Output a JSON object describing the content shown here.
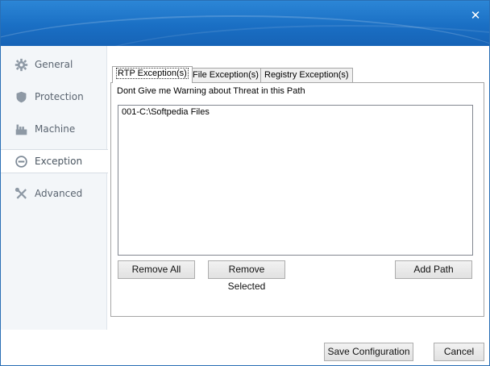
{
  "window": {
    "close_glyph": "✕"
  },
  "sidebar": {
    "items": [
      {
        "label": "General",
        "icon": "gear-icon",
        "active": false
      },
      {
        "label": "Protection",
        "icon": "shield-icon",
        "active": false
      },
      {
        "label": "Machine",
        "icon": "machine-icon",
        "active": false
      },
      {
        "label": "Exception",
        "icon": "minus-circle-icon",
        "active": true
      },
      {
        "label": "Advanced",
        "icon": "tools-icon",
        "active": false
      }
    ]
  },
  "tabs": [
    {
      "label": "RTP Exception(s)",
      "active": true
    },
    {
      "label": "File Exception(s)",
      "active": false
    },
    {
      "label": "Registry Exception(s)",
      "active": false
    }
  ],
  "rtp": {
    "description": "Dont Give me Warning about Threat in this Path",
    "paths": [
      "001-C:\\Softpedia Files"
    ],
    "remove_all_label": "Remove All",
    "remove_selected_label": "Remove Selected",
    "add_path_label": "Add Path"
  },
  "footer": {
    "save_label": "Save Configuration",
    "cancel_label": "Cancel"
  },
  "colors": {
    "titlebar": "#1a6fc4",
    "sidebar_bg": "#f3f6f9"
  }
}
